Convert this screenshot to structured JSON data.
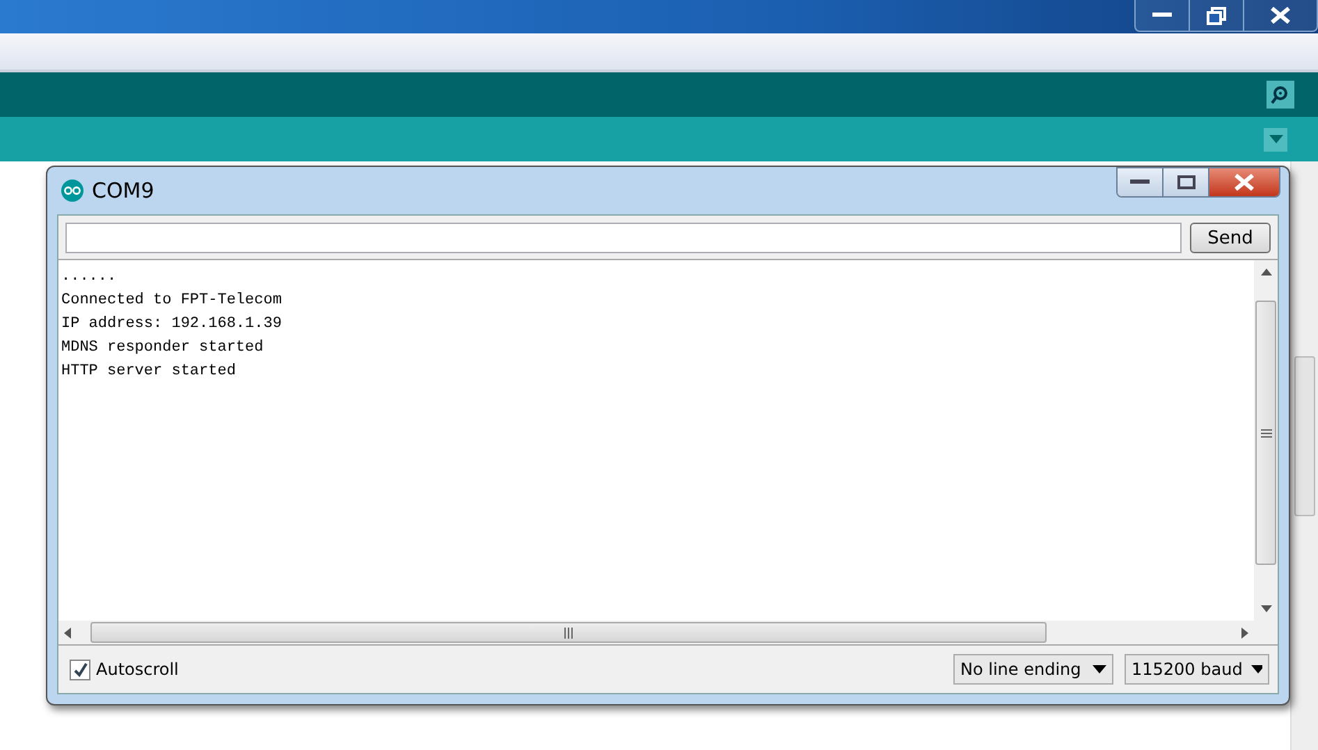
{
  "serial_monitor": {
    "title": "COM9",
    "send_button": "Send",
    "output_lines": [
      "......",
      "Connected to FPT-Telecom",
      "IP address: 192.168.1.39",
      "MDNS responder started",
      "HTTP server started"
    ],
    "autoscroll": {
      "label": "Autoscroll",
      "checked": true
    },
    "line_ending": "No line ending",
    "baud_rate": "115200 baud"
  }
}
